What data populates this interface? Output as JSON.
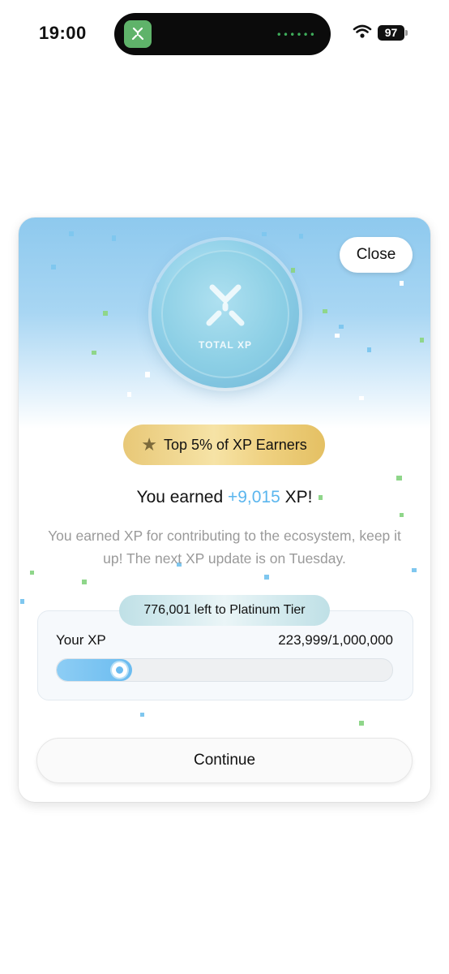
{
  "status_bar": {
    "time": "19:00",
    "battery": "97",
    "island_dots": "••••••"
  },
  "modal": {
    "close_label": "Close",
    "coin_label": "TOTAL XP",
    "badge_label": "Top 5% of XP Earners",
    "headline_prefix": "You earned ",
    "headline_amount": "+9,015",
    "headline_suffix": " XP!",
    "description": "You earned XP for contributing to the ecosystem, keep it up! The next XP update is on Tuesday.",
    "tier_text": "776,001 left to Platinum Tier",
    "xp_label": "Your XP",
    "xp_value": "223,999/1,000,000",
    "xp_progress": 0.224,
    "continue_label": "Continue"
  },
  "colors": {
    "accent_blue": "#5bb6ee",
    "badge_gold": "#efd181",
    "app_green": "#5fb36a"
  },
  "icons": {
    "app": "app-logo-icon",
    "wifi": "wifi-icon",
    "star": "star-icon",
    "coin": "xp-coin-icon"
  }
}
